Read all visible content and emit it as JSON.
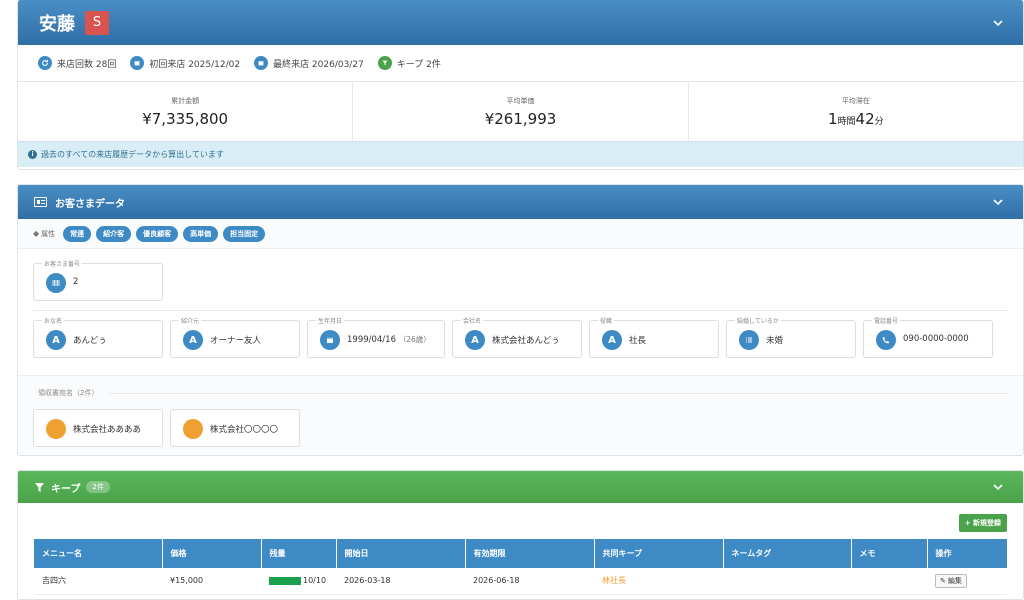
{
  "header": {
    "name": "安藤",
    "rank": "S"
  },
  "stats": [
    {
      "icon": "refresh-icon",
      "label": "来店回数 28回"
    },
    {
      "icon": "calendar-icon",
      "label": "初回来店 2025/12/02"
    },
    {
      "icon": "calendar-icon",
      "label": "最終来店 2026/03/27"
    },
    {
      "icon": "filter-icon",
      "label": "キープ 2件"
    }
  ],
  "summary": [
    {
      "label": "累計金額",
      "value": "¥7,335,800"
    },
    {
      "label": "平均単価",
      "value": "¥261,993"
    },
    {
      "label": "平均滞在",
      "h": "1",
      "hu": "時間",
      "m": "42",
      "mu": "分"
    }
  ],
  "info_note": "過去のすべての来店履歴データから算出しています",
  "customer": {
    "title": "お客さまデータ",
    "attr_label": "属性",
    "tags": [
      "常連",
      "紹介客",
      "優良顧客",
      "高単価",
      "担当固定"
    ],
    "number": {
      "label": "お客さま番号",
      "value": "2"
    },
    "fields": [
      {
        "label": "おな名",
        "value": "あんどぅ",
        "avatar": "A"
      },
      {
        "label": "紹介元",
        "value": "オーナー友人",
        "avatar": "A"
      },
      {
        "label": "生年月日",
        "value": "1999/04/16",
        "extra": "（26歳）",
        "icon": "calendar-icon"
      },
      {
        "label": "会社名",
        "value": "株式会社あんどぅ",
        "avatar": "A"
      },
      {
        "label": "役職",
        "value": "社長",
        "avatar": "A"
      },
      {
        "label": "結婚しているか",
        "value": "未婚",
        "icon": "list-icon"
      },
      {
        "label": "電話番号",
        "value": "090-0000-0000",
        "icon": "phone-icon"
      }
    ],
    "receipt": {
      "label": "領収書宛名（2件）",
      "items": [
        "株式会社ああああ",
        "株式会社〇〇〇〇"
      ]
    }
  },
  "keep": {
    "title": "キープ",
    "count": "2件",
    "new_button": "+ 新規登録",
    "columns": [
      "メニュー名",
      "価格",
      "残量",
      "開始日",
      "有効期限",
      "共同キープ",
      "ネームタグ",
      "メモ",
      "操作"
    ],
    "rows": [
      {
        "menu": "吉四六",
        "price": "¥15,000",
        "remaining": "10/10",
        "remaining_fraction": 1.0,
        "start": "2026-03-18",
        "expiry": "2026-06-18",
        "shared": "林社長",
        "tag": "",
        "memo": "",
        "action": "編集"
      }
    ]
  },
  "colors": {
    "primary": "#3d8ac5",
    "header": "#2f6ea6",
    "green": "#5cb85c",
    "rank": "#d9534f",
    "info": "#d9edf7",
    "orange": "#f0a030"
  }
}
